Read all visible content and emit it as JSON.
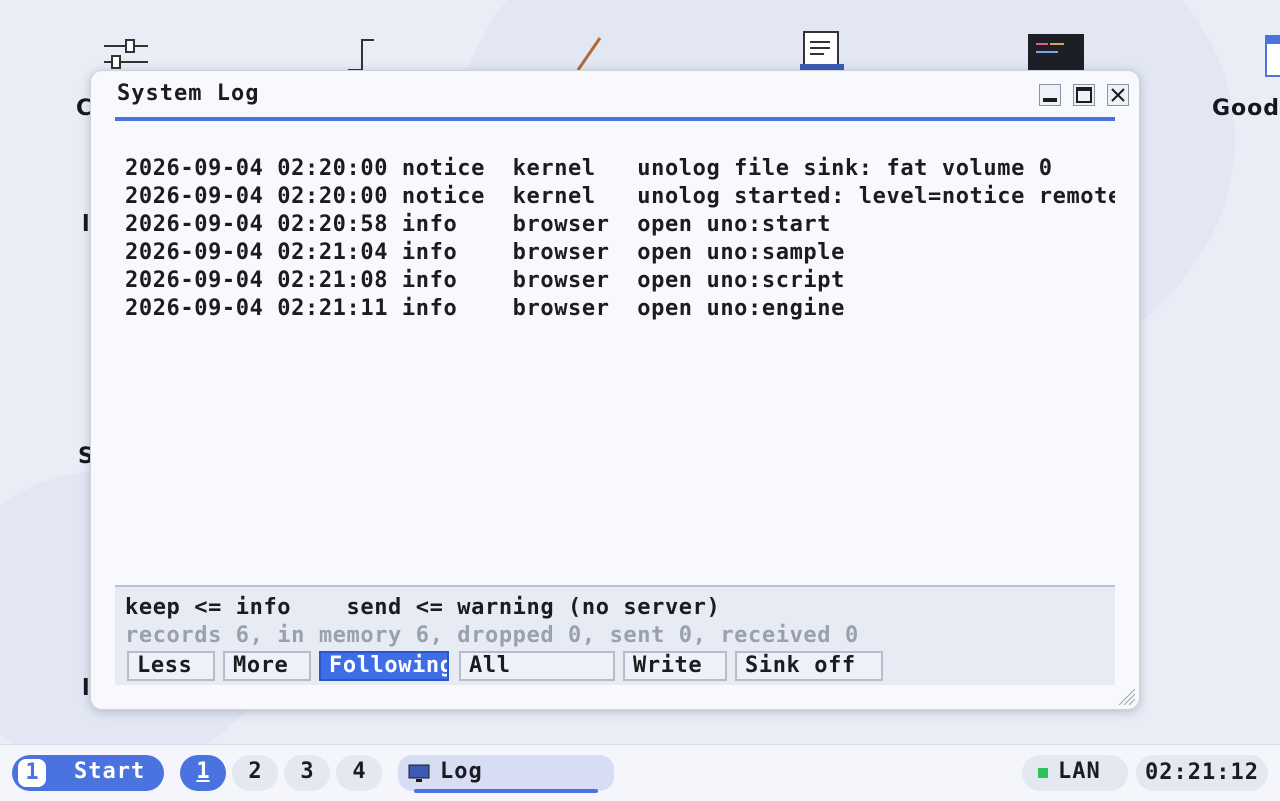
{
  "desktop": {
    "icons": [
      {
        "name": "settings-sliders-icon"
      },
      {
        "name": "chart-icon"
      },
      {
        "name": "pen-icon"
      },
      {
        "name": "document-icon"
      },
      {
        "name": "terminal-icon"
      },
      {
        "name": "file-icon",
        "label": "Good"
      }
    ],
    "partial_labels": [
      "C",
      "l",
      "S",
      "l"
    ]
  },
  "window": {
    "title": "System Log",
    "log_lines": [
      "2026-09-04 02:20:00 notice  kernel   unolog file sink: fat volume 0",
      "2026-09-04 02:20:00 notice  kernel   unolog started: level=notice remote",
      "2026-09-04 02:20:58 info    browser  open uno:start",
      "2026-09-04 02:21:04 info    browser  open uno:sample",
      "2026-09-04 02:21:08 info    browser  open uno:script",
      "2026-09-04 02:21:11 info    browser  open uno:engine"
    ],
    "levels_text": "keep <= info    send <= warning (no server)",
    "stats_text": "records 6, in memory 6, dropped 0, sent 0, received 0",
    "controls": {
      "less": "Less",
      "more": "More",
      "following": "Following",
      "all": "All",
      "write": "Write",
      "sink_off": "Sink off"
    }
  },
  "taskbar": {
    "start_number": "1",
    "start_label": "Start",
    "workspaces": [
      "1",
      "2",
      "3",
      "4"
    ],
    "active_workspace": "1",
    "task_label": "Log",
    "network_label": "LAN",
    "network_color": "#2fc15a",
    "clock": "02:21:12"
  },
  "colors": {
    "accent": "#4a73e0",
    "active_control": "#3d6ee6"
  }
}
